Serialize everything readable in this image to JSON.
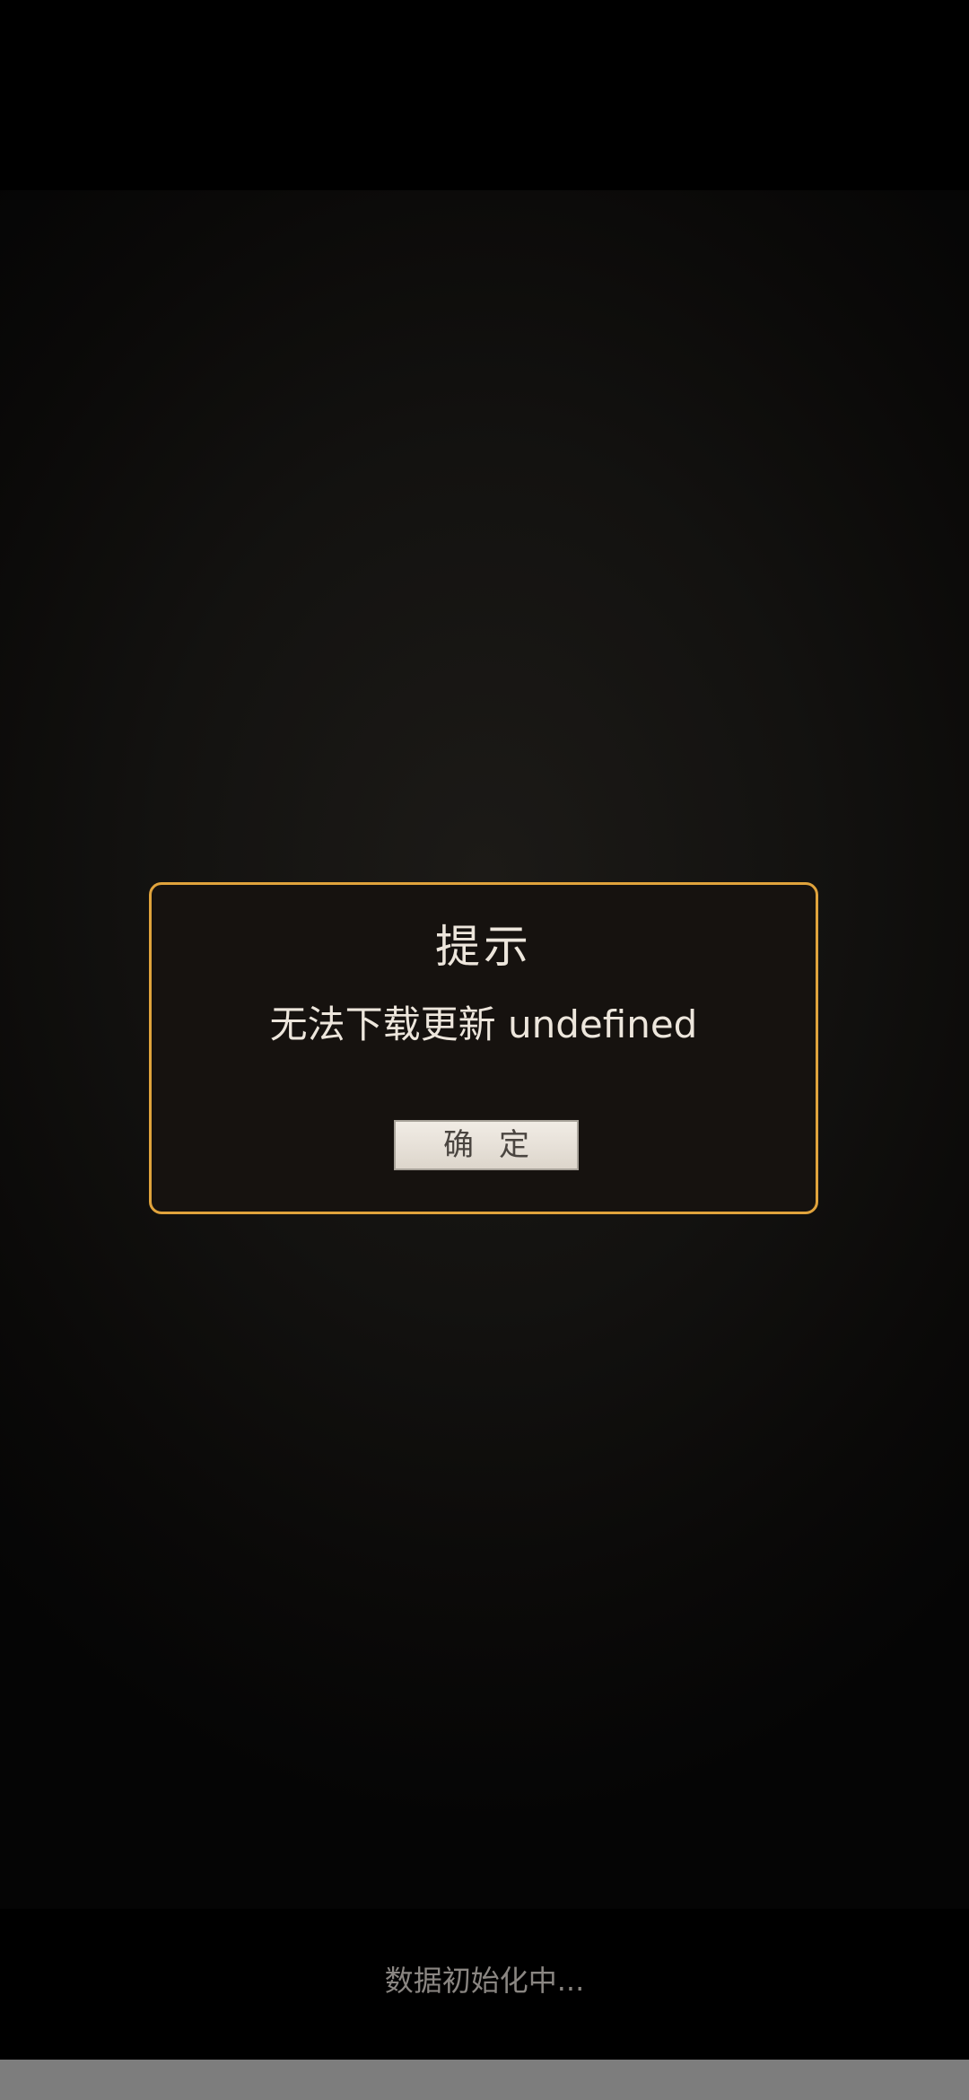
{
  "dialog": {
    "title": "提示",
    "message": "无法下载更新 undefined",
    "confirm_label": "确定"
  },
  "status": {
    "text": "数据初始化中..."
  },
  "progress": {
    "fraction": 0.0
  },
  "colors": {
    "dialog_border": "#e0a33c",
    "dialog_background": "#16120f",
    "text": "#ede6dc",
    "button_background": "#e8e2da",
    "status_text": "#8a8682",
    "progress_track": "#7d7d7d"
  }
}
